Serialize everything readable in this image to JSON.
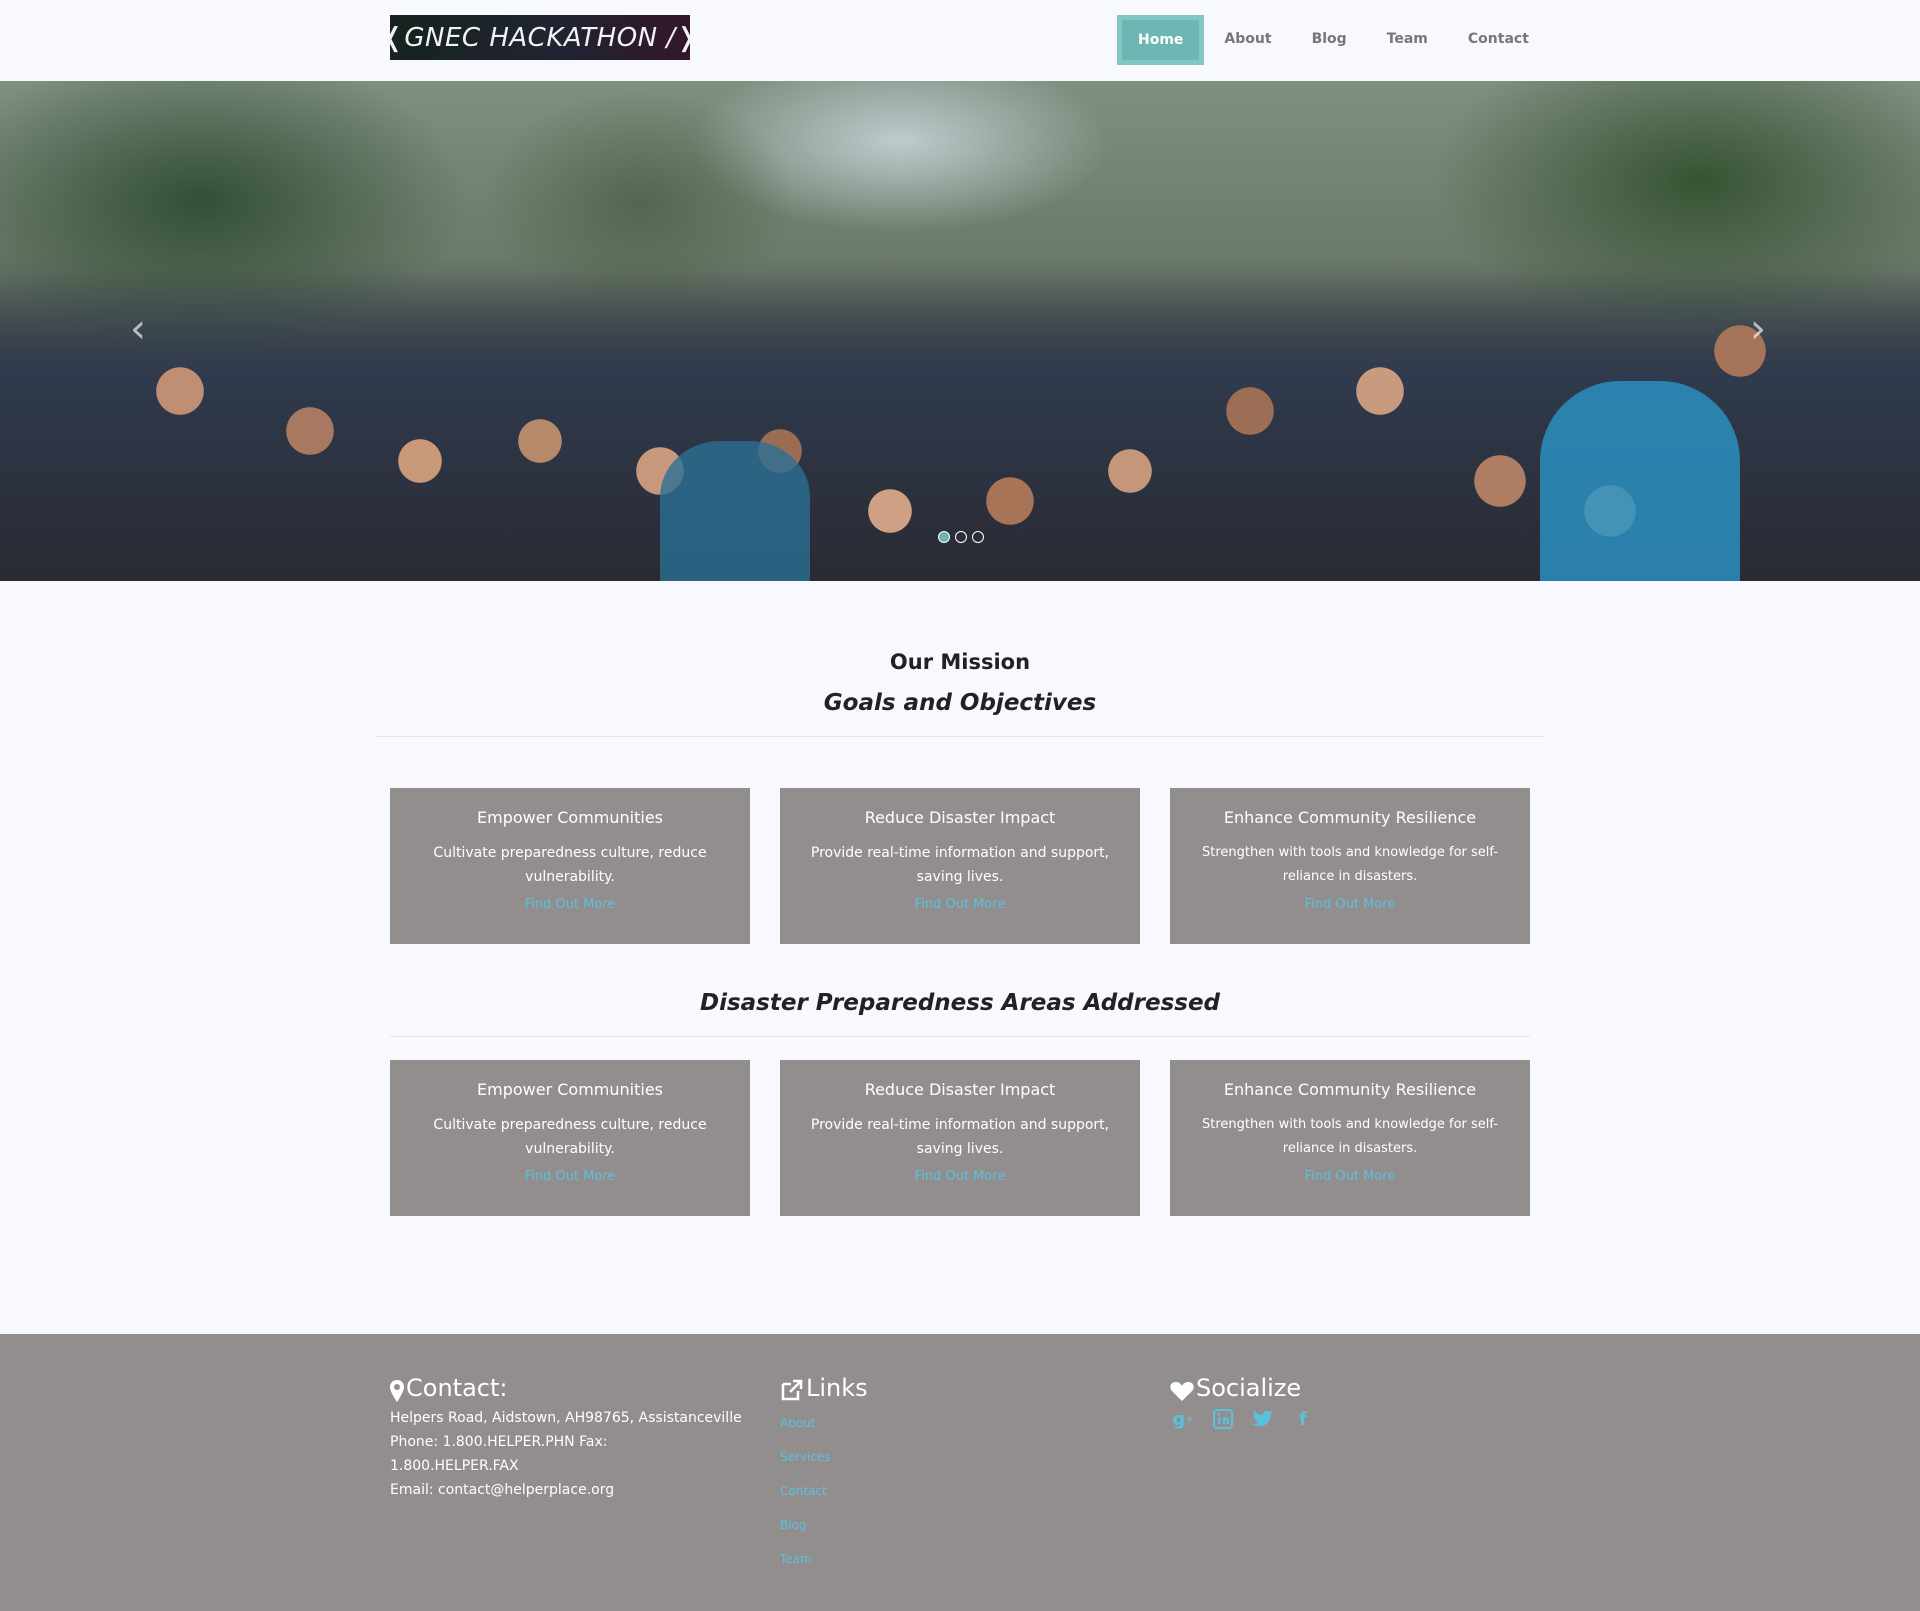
{
  "brand": {
    "logo_text": "❬GNEC HACKATHON /❭"
  },
  "nav": {
    "items": [
      "Home",
      "About",
      "Blog",
      "Team",
      "Contact"
    ],
    "active": "Home"
  },
  "carousel": {
    "slides": 3,
    "active_slide": 1,
    "prev_icon": "chevron-left-icon",
    "next_icon": "chevron-right-icon"
  },
  "mission": {
    "title": "Our Mission",
    "subtitle": "Goals and Objectives"
  },
  "goals": [
    {
      "title": "Empower Communities",
      "text": "Cultivate preparedness culture, reduce vulnerability.",
      "link": "Find Out More"
    },
    {
      "title": "Reduce Disaster Impact",
      "text": "Provide real-time information and support, saving lives.",
      "link": "Find Out More"
    },
    {
      "title": "Enhance Community Resilience",
      "text": "Strengthen with tools and knowledge for self-reliance in disasters.",
      "link": "Find Out More"
    }
  ],
  "areas": {
    "title": "Disaster Preparedness Areas Addressed",
    "items": [
      {
        "title": "Empower Communities",
        "text": "Cultivate preparedness culture, reduce vulnerability.",
        "link": "Find Out More"
      },
      {
        "title": "Reduce Disaster Impact",
        "text": "Provide real-time information and support, saving lives.",
        "link": "Find Out More"
      },
      {
        "title": "Enhance Community Resilience",
        "text": "Strengthen with tools and knowledge for self-reliance in disasters.",
        "link": "Find Out More"
      }
    ]
  },
  "footer": {
    "contact": {
      "title": "Contact:",
      "icon": "map-marker-icon",
      "address": "Helpers Road, Aidstown, AH98765, Assistanceville",
      "phone_fax_1": "Phone: 1.800.HELPER.PHN Fax:",
      "phone_fax_2": "1.800.HELPER.FAX",
      "email": "Email: contact@helperplace.org"
    },
    "links": {
      "title": "Links",
      "icon": "external-link-icon",
      "items": [
        "About",
        "Services",
        "Contact",
        "Blog",
        "Team"
      ]
    },
    "social": {
      "title": "Socialize",
      "icon": "heart-icon",
      "icons": [
        "google-plus-icon",
        "linkedin-icon",
        "twitter-icon",
        "facebook-icon"
      ]
    }
  },
  "colors": {
    "accent": "#6eb6b4",
    "card_bg": "#938e8e",
    "link": "#5bc0de",
    "page_bg": "#f8f9fe"
  }
}
